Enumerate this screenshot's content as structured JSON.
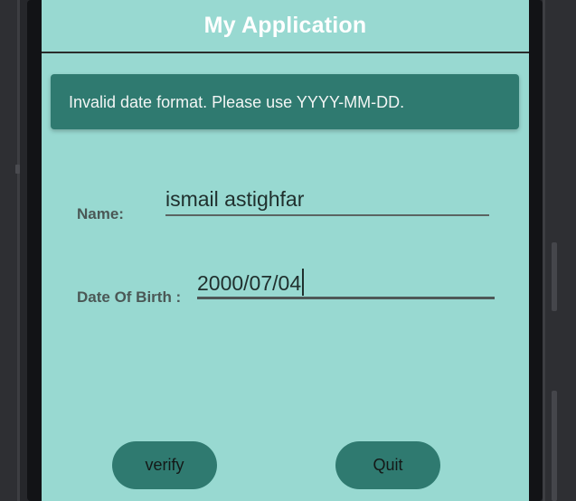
{
  "app": {
    "title": "My Application"
  },
  "snackbar": {
    "message": "Invalid date format. Please use YYYY-MM-DD."
  },
  "form": {
    "name_label": "Name:",
    "name_value": "ismail astighfar",
    "dob_label": "Date Of Birth :",
    "dob_value": "2000/07/04"
  },
  "buttons": {
    "verify_label": "verify",
    "quit_label": "Quit"
  },
  "colors": {
    "screen_background": "#98d9d1",
    "accent": "#2f7a70",
    "title_text": "#ffffff"
  }
}
